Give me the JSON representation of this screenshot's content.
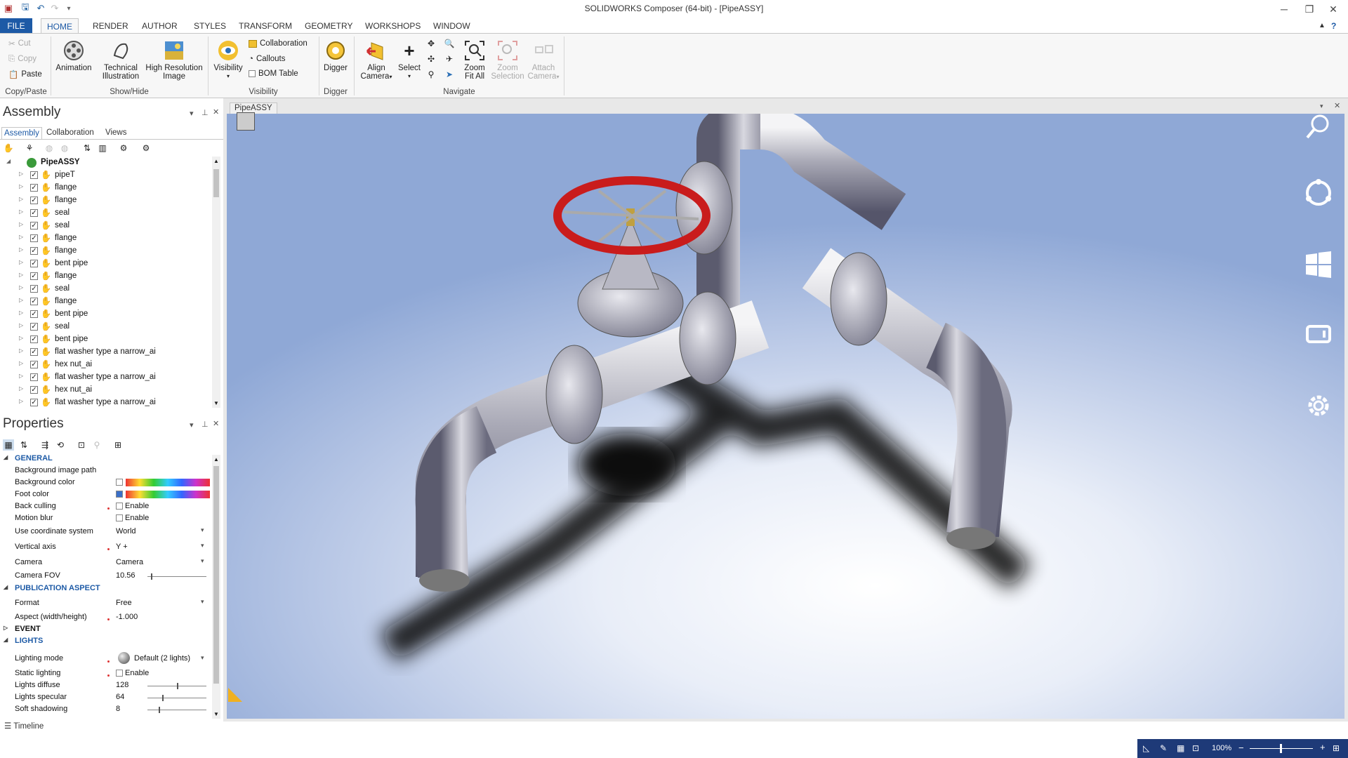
{
  "window": {
    "title": "SOLIDWORKS Composer (64-bit) - [PipeASSY]"
  },
  "ribbon_tabs": [
    "FILE",
    "HOME",
    "RENDER",
    "AUTHOR",
    "STYLES",
    "TRANSFORM",
    "GEOMETRY",
    "WORKSHOPS",
    "WINDOW"
  ],
  "ribbon": {
    "clipboard": {
      "cut": "Cut",
      "copy": "Copy",
      "paste": "Paste",
      "group": "Copy/Paste"
    },
    "showhide": {
      "animation": "Animation",
      "technical": "Technical",
      "illustration": "Illustration",
      "high_res": "High Resolution",
      "image": "Image",
      "group": "Show/Hide"
    },
    "visibility": {
      "visibility": "Visibility",
      "collaboration": "Collaboration",
      "callouts": "Callouts",
      "bom_table": "BOM Table",
      "group": "Visibility"
    },
    "digger": {
      "digger": "Digger",
      "group": "Digger"
    },
    "navigate": {
      "align": "Align",
      "camera": "Camera",
      "select": "Select",
      "zoom": "Zoom",
      "fit_all": "Fit All",
      "zoom2": "Zoom",
      "selection": "Selection",
      "attach": "Attach",
      "camera2": "Camera",
      "group": "Navigate"
    }
  },
  "assembly_pane": {
    "title": "Assembly",
    "tabs": [
      "Assembly",
      "Collaboration",
      "Views"
    ],
    "root": "PipeASSY",
    "items": [
      "pipeT",
      "flange",
      "flange",
      "seal",
      "seal",
      "flange",
      "flange",
      "bent pipe",
      "flange",
      "seal",
      "flange",
      "bent pipe",
      "seal",
      "bent pipe",
      "flat washer type a narrow_ai",
      "hex nut_ai",
      "flat washer type a narrow_ai",
      "hex nut_ai",
      "flat washer type a narrow_ai"
    ]
  },
  "properties_pane": {
    "title": "Properties",
    "general": "GENERAL",
    "bg_image_path": "Background image path",
    "bg_color": "Background color",
    "foot_color": "Foot color",
    "back_culling": "Back culling",
    "motion_blur": "Motion blur",
    "enable": "Enable",
    "use_coord": "Use coordinate system",
    "use_coord_val": "World",
    "vertical_axis": "Vertical axis",
    "vertical_axis_val": "Y +",
    "camera": "Camera",
    "camera_val": "Camera",
    "camera_fov": "Camera FOV",
    "camera_fov_val": "10.56",
    "pub_aspect": "PUBLICATION ASPECT",
    "format": "Format",
    "format_val": "Free",
    "aspect": "Aspect (width/height)",
    "aspect_val": "-1.000",
    "event": "EVENT",
    "lights": "LIGHTS",
    "lighting_mode": "Lighting mode",
    "lighting_mode_val": "Default (2 lights)",
    "static_lighting": "Static lighting",
    "lights_diffuse": "Lights diffuse",
    "lights_diffuse_val": "128",
    "lights_specular": "Lights specular",
    "lights_specular_val": "64",
    "soft_shadowing": "Soft shadowing",
    "soft_shadowing_val": "8"
  },
  "document_tab": "PipeASSY",
  "timeline": "Timeline",
  "status": {
    "zoom": "100%"
  },
  "colors": {
    "accent": "#1d5aa6",
    "statusbar": "#1e3a78",
    "valve_wheel": "#c91c1c"
  },
  "right_toolbar_icons": [
    "search-icon",
    "rotate-icon",
    "windows-icon",
    "device-icon",
    "settings-icon"
  ]
}
